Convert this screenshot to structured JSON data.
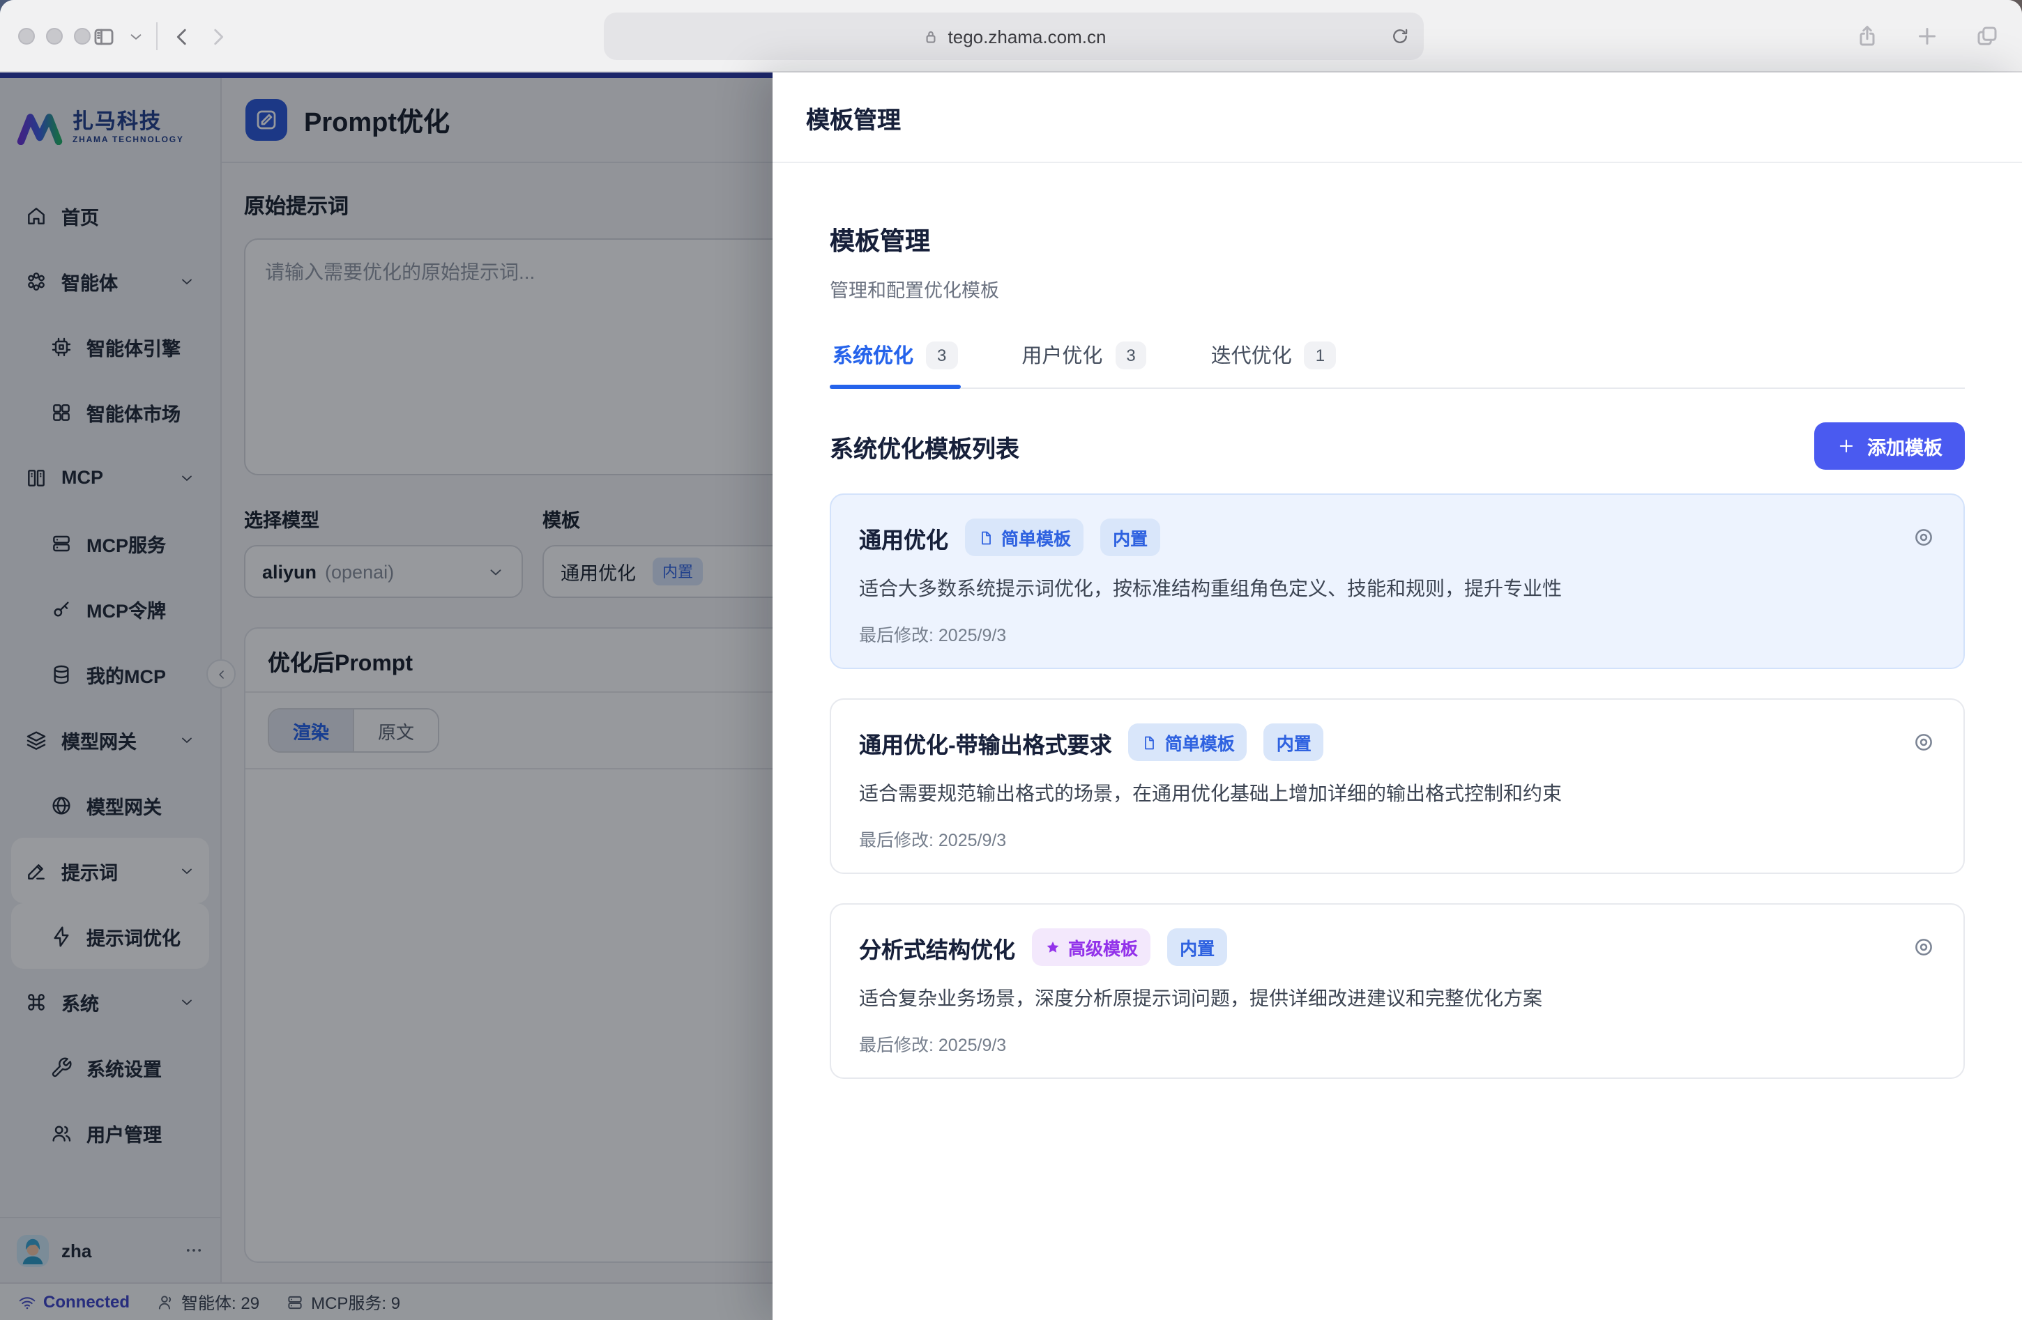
{
  "browser": {
    "url": "tego.zhama.com.cn"
  },
  "brand": {
    "name": "扎马科技",
    "subtitle": "ZHAMA TECHNOLOGY"
  },
  "sidebar": {
    "items": [
      {
        "label": "首页",
        "icon": "home-icon"
      },
      {
        "label": "智能体",
        "icon": "blossom-icon"
      },
      {
        "label": "智能体引擎",
        "icon": "cpu-icon"
      },
      {
        "label": "智能体市场",
        "icon": "apps-icon"
      },
      {
        "label": "MCP",
        "icon": "library-icon"
      },
      {
        "label": "MCP服务",
        "icon": "server-icon"
      },
      {
        "label": "MCP令牌",
        "icon": "key-icon"
      },
      {
        "label": "我的MCP",
        "icon": "database-icon"
      },
      {
        "label": "模型网关",
        "icon": "layers-icon"
      },
      {
        "label": "模型网关",
        "icon": "globe-icon"
      },
      {
        "label": "提示词",
        "icon": "pencil-icon"
      },
      {
        "label": "提示词优化",
        "icon": "zap-icon"
      },
      {
        "label": "系统",
        "icon": "command-icon"
      },
      {
        "label": "系统设置",
        "icon": "wrench-icon"
      },
      {
        "label": "用户管理",
        "icon": "users-icon"
      }
    ],
    "user": {
      "name": "zha"
    }
  },
  "statusbar": {
    "connected": "Connected",
    "agents": "智能体: 29",
    "mcp": "MCP服务: 9"
  },
  "main": {
    "title": "Prompt优化",
    "original_label": "原始提示词",
    "textarea_placeholder": "请输入需要优化的原始提示词...",
    "model_label": "选择模型",
    "model_value": "aliyun",
    "model_suffix": "(openai)",
    "template_label": "模板",
    "template_value": "通用优化",
    "template_badge": "内置",
    "optimized_title": "优化后Prompt",
    "tab_render": "渲染",
    "tab_raw": "原文"
  },
  "panel": {
    "header": "模板管理",
    "section_title": "模板管理",
    "section_subtitle": "管理和配置优化模板",
    "tabs": [
      {
        "label": "系统优化",
        "count": "3"
      },
      {
        "label": "用户优化",
        "count": "3"
      },
      {
        "label": "迭代优化",
        "count": "1"
      }
    ],
    "list_title": "系统优化模板列表",
    "add_button": "添加模板",
    "cards": [
      {
        "title": "通用优化",
        "type_badge": "简单模板",
        "builtin": "内置",
        "desc": "适合大多数系统提示词优化，按标准结构重组角色定义、技能和规则，提升专业性",
        "modified": "最后修改: 2025/9/3"
      },
      {
        "title": "通用优化-带输出格式要求",
        "type_badge": "简单模板",
        "builtin": "内置",
        "desc": "适合需要规范输出格式的场景，在通用优化基础上增加详细的输出格式控制和约束",
        "modified": "最后修改: 2025/9/3"
      },
      {
        "title": "分析式结构优化",
        "type_badge": "高级模板",
        "builtin": "内置",
        "desc": "适合复杂业务场景，深度分析原提示词问题，提供详细改进建议和完整优化方案",
        "modified": "最后修改: 2025/9/3"
      }
    ]
  },
  "colors": {
    "accent_blue": "#2563eb",
    "button_blue": "#4a5af0",
    "top_line_navy": "#2c39a8",
    "selected_card_bg": "#edf3fe",
    "badge_blue_bg": "#d9e6fa",
    "badge_purple": "#9333ea",
    "badge_purple_bg": "#f3e8fc",
    "connected_blue": "#3f46c9"
  },
  "icons": [
    "home",
    "blossom",
    "cpu",
    "apps",
    "library",
    "server",
    "key",
    "database",
    "layers",
    "globe",
    "pencil",
    "zap",
    "command",
    "wrench",
    "users",
    "chevron-down",
    "chevron-left",
    "wifi",
    "person",
    "server-small",
    "edit-square",
    "eye",
    "document",
    "star",
    "plus",
    "lock",
    "reload",
    "share",
    "new-tab",
    "tab-overview",
    "sidebar-toggle",
    "back",
    "forward",
    "ellipsis"
  ]
}
